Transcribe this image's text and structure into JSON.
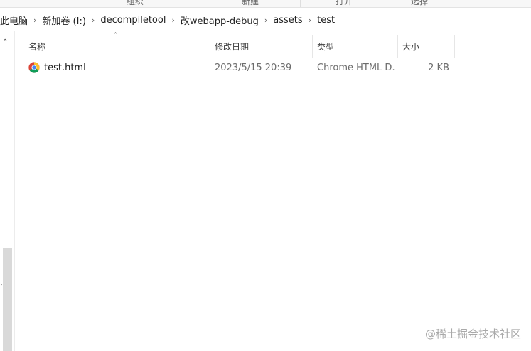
{
  "ribbon": {
    "groups": [
      "组织",
      "新建",
      "打开",
      "选择"
    ]
  },
  "address": {
    "crumbs": [
      "此电脑",
      "新加卷 (I:)",
      "decompiletool",
      "改webapp-debug",
      "assets",
      "test"
    ],
    "separator": "›"
  },
  "columns": {
    "name": "名称",
    "date": "修改日期",
    "type": "类型",
    "size": "大小"
  },
  "files": [
    {
      "name": "test.html",
      "modified": "2023/5/15 20:39",
      "type": "Chrome HTML D...",
      "size": "2 KB",
      "icon": "chrome-icon"
    }
  ],
  "nav_stray_text": "r",
  "watermark": "@稀土掘金技术社区"
}
